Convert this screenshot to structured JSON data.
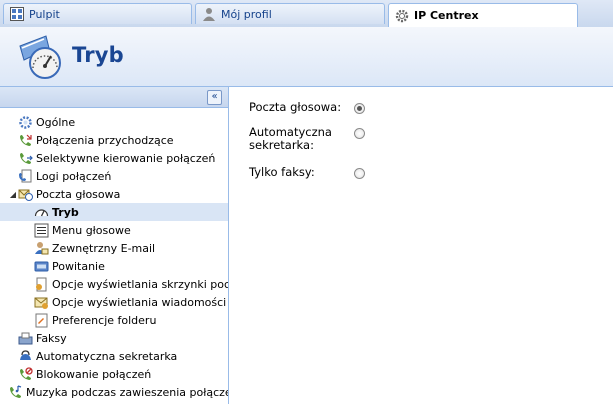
{
  "tabs": [
    {
      "label": "Pulpit",
      "icon": "dashboard-icon"
    },
    {
      "label": "Mój profil",
      "icon": "user-icon"
    },
    {
      "label": "IP Centrex",
      "icon": "gear-icon",
      "active": true
    }
  ],
  "header": {
    "title": "Tryb",
    "icon": "voicemail-mode-icon"
  },
  "sidebar": {
    "collapse_glyph": "«",
    "items": [
      {
        "label": "Ogólne"
      },
      {
        "label": "Połączenia przychodzące"
      },
      {
        "label": "Selektywne kierowanie połączeń"
      },
      {
        "label": "Logi połączeń"
      },
      {
        "label": "Poczta głosowa"
      },
      {
        "label": "Tryb"
      },
      {
        "label": "Menu głosowe"
      },
      {
        "label": "Zewnętrzny E-mail"
      },
      {
        "label": "Powitanie"
      },
      {
        "label": "Opcje wyświetlania skrzynki poczto"
      },
      {
        "label": "Opcje wyświetlania wiadomości"
      },
      {
        "label": "Preferencje folderu"
      },
      {
        "label": "Faksy"
      },
      {
        "label": "Automatyczna sekretarka"
      },
      {
        "label": "Blokowanie połączeń"
      },
      {
        "label": "Muzyka podczas zawieszenia połączer"
      }
    ]
  },
  "form": {
    "options": [
      {
        "label": "Poczta głosowa:",
        "checked": true
      },
      {
        "label": "Automatyczna sekretarka:",
        "checked": false
      },
      {
        "label": "Tylko faksy:",
        "checked": false
      }
    ]
  },
  "colors": {
    "accent": "#1a4693",
    "border": "#99bbe8",
    "selected": "#d9e5f5"
  }
}
